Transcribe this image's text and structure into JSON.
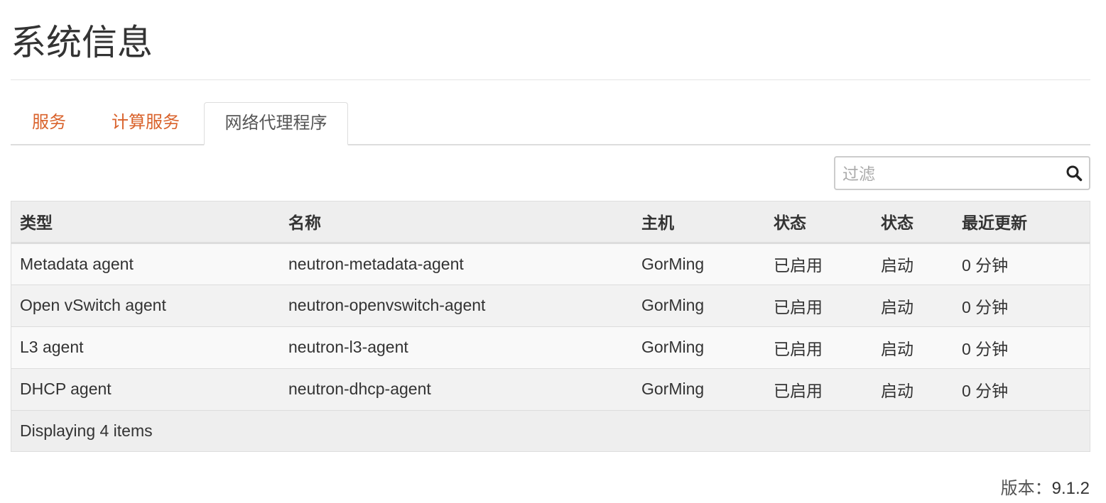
{
  "page": {
    "title": "系统信息"
  },
  "tabs": [
    {
      "label": "服务",
      "active": false
    },
    {
      "label": "计算服务",
      "active": false
    },
    {
      "label": "网络代理程序",
      "active": true
    }
  ],
  "filter": {
    "placeholder": "过滤",
    "value": "",
    "icon": "search-icon"
  },
  "table": {
    "columns": [
      "类型",
      "名称",
      "主机",
      "状态",
      "状态",
      "最近更新"
    ],
    "rows": [
      [
        "Metadata agent",
        "neutron-metadata-agent",
        "GorMing",
        "已启用",
        "启动",
        "0 分钟"
      ],
      [
        "Open vSwitch agent",
        "neutron-openvswitch-agent",
        "GorMing",
        "已启用",
        "启动",
        "0 分钟"
      ],
      [
        "L3 agent",
        "neutron-l3-agent",
        "GorMing",
        "已启用",
        "启动",
        "0 分钟"
      ],
      [
        "DHCP agent",
        "neutron-dhcp-agent",
        "GorMing",
        "已启用",
        "启动",
        "0 分钟"
      ]
    ],
    "footer": "Displaying 4 items"
  },
  "version": {
    "label": "版本：",
    "number": "9.1.2"
  },
  "colors": {
    "tab_link": "#d9622b",
    "header_bg": "#eeeeee",
    "border": "#dddddd"
  }
}
